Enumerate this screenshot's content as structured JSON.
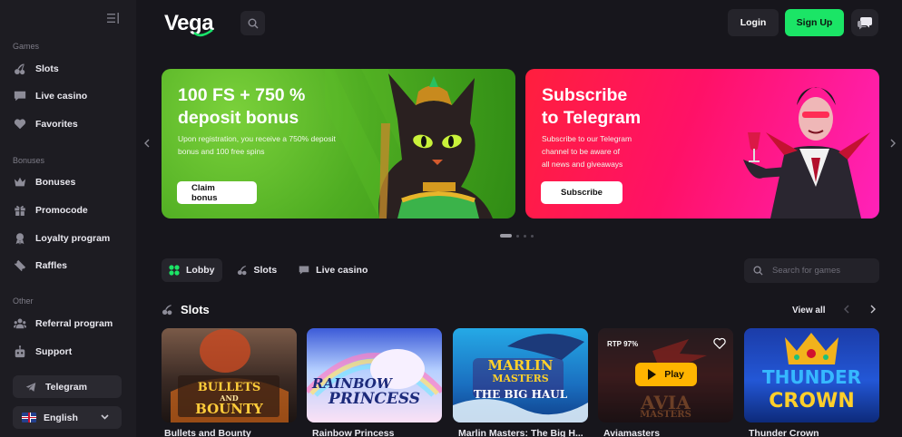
{
  "sidebar": {
    "sections": {
      "games": "Games",
      "bonuses": "Bonuses",
      "other": "Other"
    },
    "items": {
      "slots": "Slots",
      "live_casino": "Live casino",
      "favorites": "Favorites",
      "bonuses": "Bonuses",
      "promocode": "Promocode",
      "loyalty": "Loyalty program",
      "raffles": "Raffles",
      "referral": "Referral program",
      "support": "Support"
    },
    "telegram": "Telegram",
    "language": "English"
  },
  "header": {
    "logo": "Vega",
    "login": "Login",
    "signup": "Sign Up"
  },
  "banners": [
    {
      "title_line1": "100 FS + 750 %",
      "title_line2": "deposit bonus",
      "desc_line1": "Upon registration, you receive a 750% deposit",
      "desc_line2": "bonus and 100 free spins",
      "button": "Claim bonus"
    },
    {
      "title_line1": "Subscribe",
      "title_line2": "to Telegram",
      "desc_line1": "Subscribe to our Telegram",
      "desc_line2": "channel to be aware of",
      "desc_line3": "all news and giveaways",
      "button": "Subscribe"
    }
  ],
  "tabs": {
    "lobby": "Lobby",
    "slots": "Slots",
    "live_casino": "Live casino"
  },
  "search": {
    "placeholder": "Search for games"
  },
  "slots_section": {
    "title": "Slots",
    "view_all": "View all"
  },
  "games": [
    {
      "name": "Bullets and Bounty",
      "art_line1": "BULLETS",
      "art_line2": "AND",
      "art_line3": "BOUNTY"
    },
    {
      "name": "Rainbow Princess",
      "art_line1": "RAINBOW",
      "art_line2": "PRINCESS"
    },
    {
      "name": "Marlin Masters: The Big H...",
      "art_line1": "MARLIN",
      "art_line2": "MASTERS",
      "art_line3": "THE BIG HAUL"
    },
    {
      "name": "Aviamasters",
      "rtp": "RTP 97%",
      "play": "Play",
      "art_line1": "AVIA",
      "art_line2": "MASTERS"
    },
    {
      "name": "Thunder Crown",
      "art_line1": "THUNDER",
      "art_line2": "CROWN"
    }
  ],
  "colors": {
    "accent_green": "#1be566",
    "background": "#17161c",
    "sidebar": "#1d1c22",
    "play_button": "#ffb400"
  },
  "carousel": {
    "active_index": 0,
    "count": 4
  }
}
